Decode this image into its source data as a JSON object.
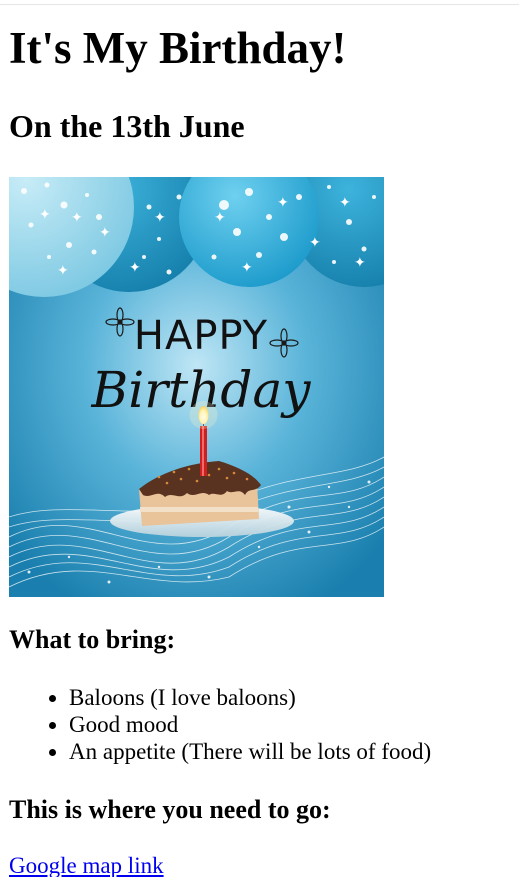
{
  "page": {
    "title": "It's My Birthday!",
    "subtitle": "On the 13th June"
  },
  "image": {
    "icon": "birthday-cake-image",
    "happy_text": "HAPPY",
    "birthday_text": "Birthday",
    "colors": {
      "background": "#1e8fbf",
      "balloon_light": "#8fd3ea",
      "balloon_mid": "#2aa3cf",
      "candle": "#d01f1f",
      "chocolate": "#5a3220",
      "sponge": "#e9c39a"
    }
  },
  "bring": {
    "heading": "What to bring:",
    "items": [
      "Baloons (I love baloons)",
      "Good mood",
      "An appetite (There will be lots of food)"
    ]
  },
  "directions": {
    "heading": "This is where you need to go:",
    "link_text": "Google map link"
  }
}
